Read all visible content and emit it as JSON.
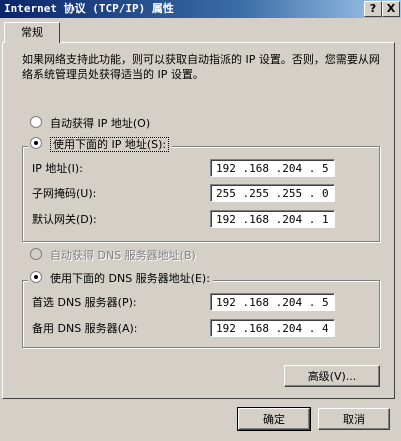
{
  "window": {
    "title": "Internet 协议 (TCP/IP) 属性",
    "help_glyph": "?",
    "close_glyph": "X"
  },
  "tabs": [
    {
      "label": "常规"
    }
  ],
  "intro_text": "如果网络支持此功能，则可以获取自动指派的 IP 设置。否则，您需要从网络系统管理员处获得适当的 IP 设置。",
  "ip_section": {
    "auto_option": "自动获得 IP 地址(O)",
    "manual_option": "使用下面的 IP 地址(S):",
    "selected": "manual",
    "fields": [
      {
        "label": "IP 地址(I):",
        "value": "192 .168 .204 . 5"
      },
      {
        "label": "子网掩码(U):",
        "value": "255 .255 .255 . 0"
      },
      {
        "label": "默认网关(D):",
        "value": "192 .168 .204 . 1"
      }
    ]
  },
  "dns_section": {
    "auto_option": "自动获得 DNS 服务器地址(B)",
    "auto_disabled": true,
    "manual_option": "使用下面的 DNS 服务器地址(E):",
    "selected": "manual",
    "fields": [
      {
        "label": "首选 DNS 服务器(P):",
        "value": "192 .168 .204 . 5"
      },
      {
        "label": "备用 DNS 服务器(A):",
        "value": "192 .168 .204 . 4"
      }
    ]
  },
  "buttons": {
    "advanced": "高级(V)...",
    "ok": "确定",
    "cancel": "取消"
  }
}
